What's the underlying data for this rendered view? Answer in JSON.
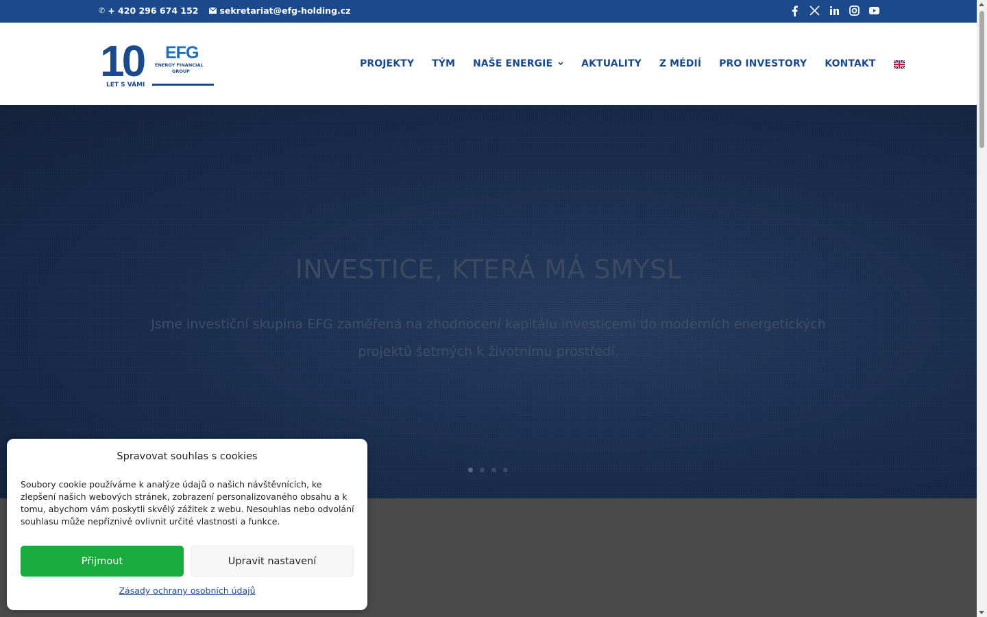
{
  "topbar": {
    "phone": "+ 420 296 674 152",
    "email": "sekretariat@efg-holding.cz",
    "social": [
      "facebook-icon",
      "x-icon",
      "linkedin-icon",
      "instagram-icon",
      "youtube-icon"
    ]
  },
  "logo": {
    "number": "10",
    "tagline": "LET S VÁMI",
    "brand": "EFG",
    "brand_line1": "ENERGY FINANCIAL",
    "brand_line2": "GROUP"
  },
  "nav": {
    "items": [
      {
        "label": "PROJEKTY"
      },
      {
        "label": "TÝM"
      },
      {
        "label": "NAŠE ENERGIE"
      },
      {
        "label": "AKTUALITY"
      },
      {
        "label": "Z MÉDIÍ"
      },
      {
        "label": "PRO INVESTORY"
      },
      {
        "label": "KONTAKT"
      }
    ],
    "language_icon": "uk-flag-icon"
  },
  "hero": {
    "title": "INVESTICE, KTERÁ MÁ SMYSL",
    "subtitle": "Jsme investiční skupina EFG zaměřená na zhodnocení kapitálu investicemi do moderních energetických projektů šetrných k životnímu prostředí.",
    "slides": 4,
    "active_slide": 1
  },
  "cookie": {
    "title": "Spravovat souhlas s cookies",
    "text": "Soubory cookie používáme k analýze údajů o našich návštěvnících, ke zlepšení našich webových stránek, zobrazení personalizovaného obsahu a k tomu, abychom vám poskytli skvělý zážitek z webu. Nesouhlas nebo odvolání souhlasu může nepříznivě ovlivnit určité vlastnosti a funkce.",
    "accept_label": "Přijmout",
    "settings_label": "Upravit nastavení",
    "privacy_link": "Zásady ochrany osobních údajů"
  },
  "colors": {
    "brand": "#1b4a8c",
    "accept": "#1aab3e"
  }
}
